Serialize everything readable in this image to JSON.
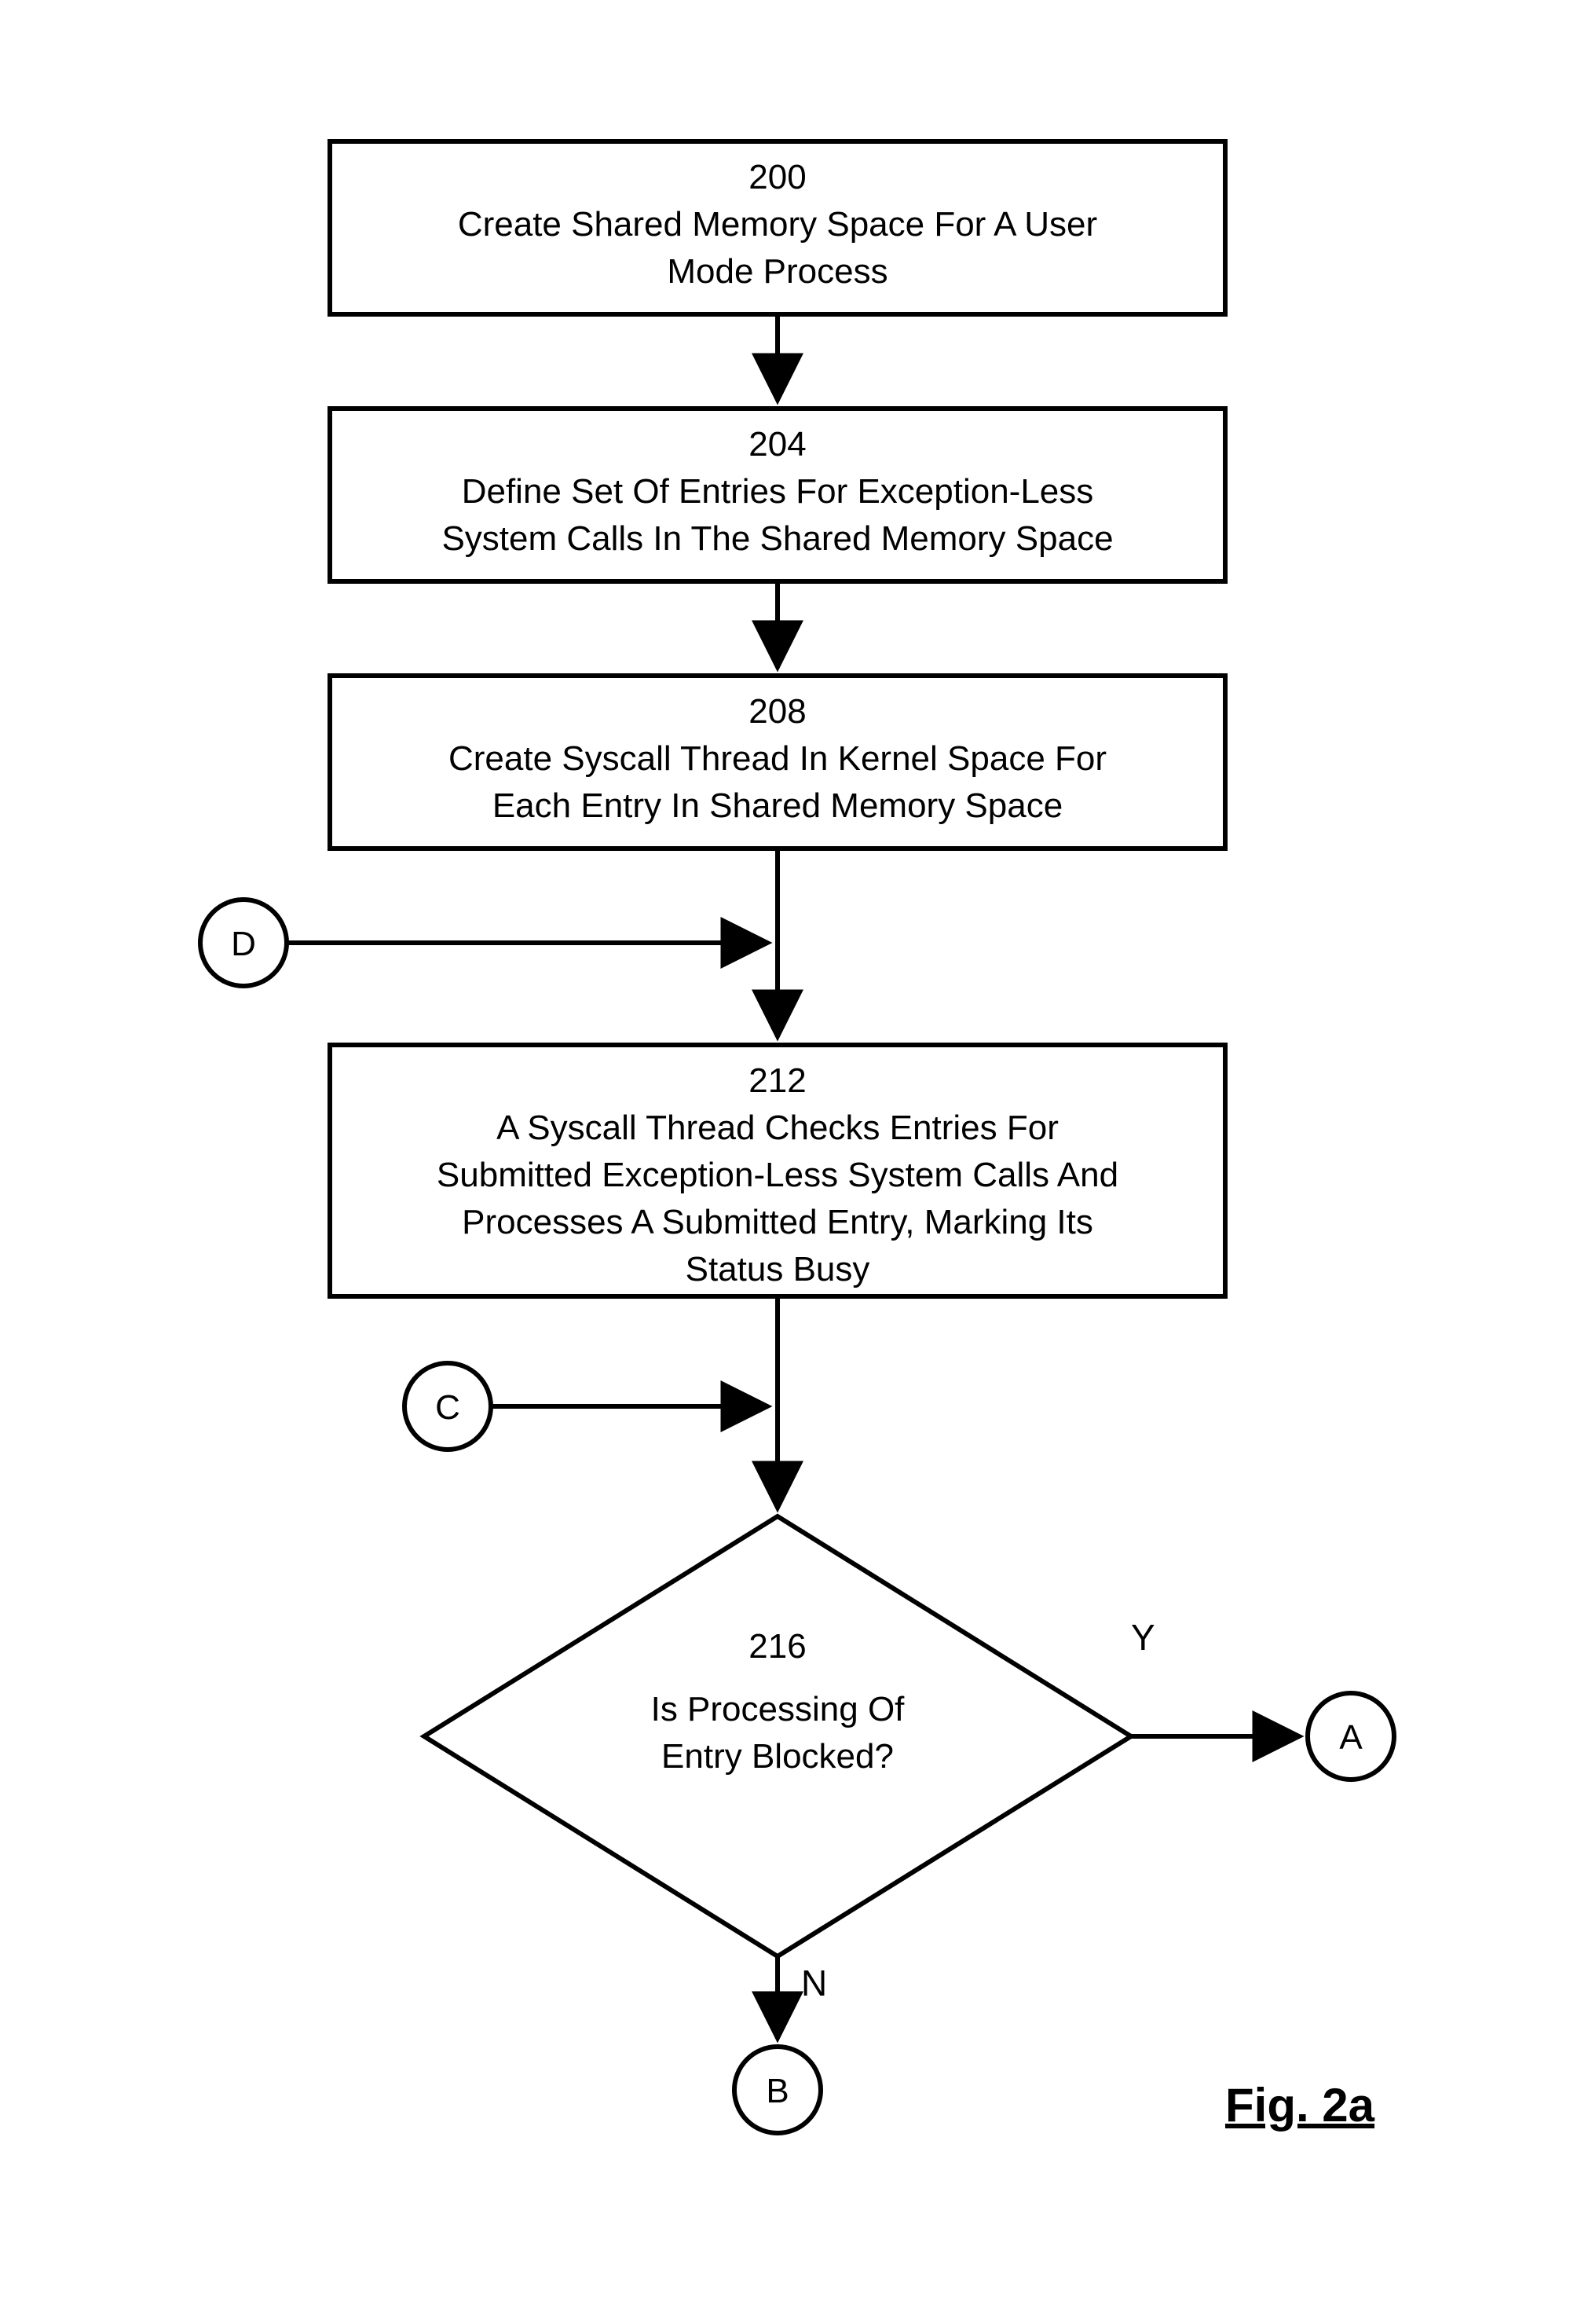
{
  "chart_data": {
    "type": "flowchart",
    "figure_label": "Fig. 2a",
    "nodes": [
      {
        "id": "200",
        "kind": "process",
        "label": "200",
        "text": "Create Shared Memory Space For A User Mode Process"
      },
      {
        "id": "204",
        "kind": "process",
        "label": "204",
        "text": "Define Set Of Entries For Exception-Less System Calls In The Shared Memory Space"
      },
      {
        "id": "208",
        "kind": "process",
        "label": "208",
        "text": "Create Syscall Thread In Kernel Space For Each Entry In Shared Memory Space"
      },
      {
        "id": "212",
        "kind": "process",
        "label": "212",
        "text": "A Syscall Thread Checks Entries For Submitted Exception-Less System Calls And Processes A Submitted Entry, Marking Its Status Busy"
      },
      {
        "id": "216",
        "kind": "decision",
        "label": "216",
        "text": "Is Processing Of Entry Blocked?"
      },
      {
        "id": "A",
        "kind": "connector",
        "label": "A"
      },
      {
        "id": "B",
        "kind": "connector",
        "label": "B"
      },
      {
        "id": "C",
        "kind": "connector",
        "label": "C"
      },
      {
        "id": "D",
        "kind": "connector",
        "label": "D"
      }
    ],
    "edges": [
      {
        "from": "200",
        "to": "204"
      },
      {
        "from": "204",
        "to": "208"
      },
      {
        "from": "208",
        "to": "212"
      },
      {
        "from": "D",
        "to": "212"
      },
      {
        "from": "212",
        "to": "216"
      },
      {
        "from": "C",
        "to": "216"
      },
      {
        "from": "216",
        "to": "A",
        "label": "Y"
      },
      {
        "from": "216",
        "to": "B",
        "label": "N"
      }
    ]
  },
  "figure_label": "Fig. 2a",
  "steps": {
    "s200": {
      "num": "200",
      "l1": "Create Shared Memory Space For A User",
      "l2": "Mode Process"
    },
    "s204": {
      "num": "204",
      "l1": "Define Set Of Entries For Exception-Less",
      "l2": "System Calls In The Shared Memory Space"
    },
    "s208": {
      "num": "208",
      "l1": "Create Syscall Thread In Kernel Space For",
      "l2": "Each Entry In Shared Memory Space"
    },
    "s212": {
      "num": "212",
      "l1": "A Syscall Thread Checks Entries For",
      "l2": "Submitted Exception-Less System Calls And",
      "l3": "Processes A Submitted Entry, Marking Its",
      "l4": "Status Busy"
    },
    "s216": {
      "num": "216",
      "l1": "Is Processing Of",
      "l2": "Entry Blocked?"
    }
  },
  "connectors": {
    "A": "A",
    "B": "B",
    "C": "C",
    "D": "D"
  },
  "labels": {
    "Y": "Y",
    "N": "N"
  }
}
